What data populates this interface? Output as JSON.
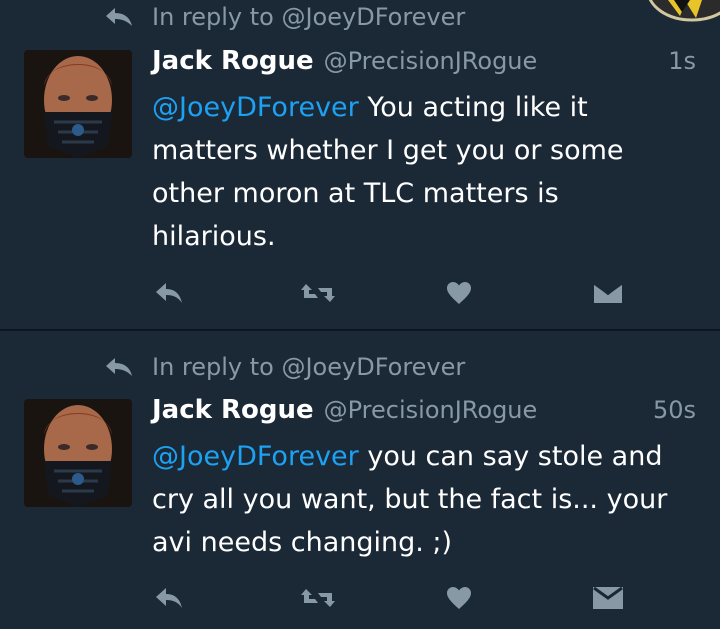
{
  "colors": {
    "background": "#1b2836",
    "divider": "#0e151d",
    "secondary_text": "#8899a6",
    "mention": "#1da1f2"
  },
  "tweets": [
    {
      "reply_context": "In reply to @JoeyDForever",
      "author_name": "Jack Rogue",
      "author_handle": "@PrecisionJRogue",
      "timestamp": "1s",
      "mention": "@JoeyDForever",
      "text_line_1": " You acting like it",
      "text_line_2": "matters whether I get you or some",
      "text_line_3": "other moron at TLC matters is",
      "text_line_4": "hilarious."
    },
    {
      "reply_context": "In reply to @JoeyDForever",
      "author_name": "Jack Rogue",
      "author_handle": "@PrecisionJRogue",
      "timestamp": "50s",
      "mention": "@JoeyDForever",
      "text_line_1": " you can say stole and",
      "text_line_2": "cry all you want, but the fact is... your",
      "text_line_3": "avi needs changing. ;)"
    }
  ],
  "icons": {
    "reply_context": "reply-arrow-icon",
    "reply": "reply-icon",
    "retweet": "retweet-icon",
    "like": "heart-icon",
    "direct_message": "envelope-icon"
  }
}
